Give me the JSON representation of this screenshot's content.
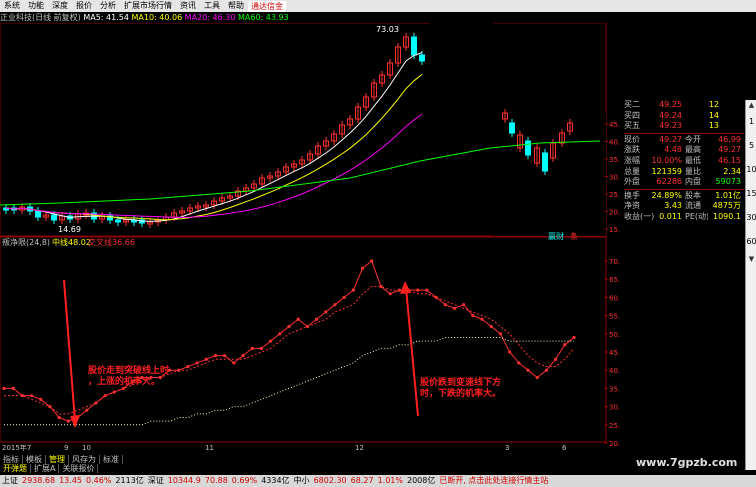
{
  "menu": {
    "items": [
      "系统",
      "功能",
      "深度",
      "报价",
      "分析",
      "扩展市场行情",
      "资讯",
      "工具",
      "帮助"
    ],
    "promo": "通达信金"
  },
  "legend": {
    "stock": "正业科技(日线 前复权)",
    "ma5": "MA5: 41.54",
    "ma10": "MA10: 40.06",
    "ma20": "MA20: 46.30",
    "ma60": "MA60: 43.93"
  },
  "price_chart": {
    "high_label": "73.03",
    "low_label": "14.69",
    "y_ticks": [
      "45.00",
      "40.00",
      "35.00",
      "30.00",
      "25.00",
      "20.00",
      "15.00"
    ]
  },
  "indicator": {
    "name": "叛净限(24,8)",
    "mid_label": "中线",
    "mid_value": "48.02",
    "cross_label": "交叉线",
    "cross_value": "36.66",
    "y_ticks": [
      "70.00",
      "65.00",
      "60.00",
      "55.00",
      "50.00",
      "45.00",
      "40.00",
      "35.00",
      "30.00",
      "25.00",
      "20.00"
    ]
  },
  "time_axis": [
    "2015年7",
    "9",
    "10",
    "11",
    "12",
    "3",
    "6"
  ],
  "annotations": {
    "left": [
      "股价走到突破线上时",
      "，上涨的机率大。"
    ],
    "right": [
      "股价跌到变速线下方",
      "时，下跌的机率大。"
    ]
  },
  "chart_data": {
    "type": "line",
    "title": "",
    "xlabel": "",
    "ylabel": "",
    "ylim": [
      20,
      75
    ],
    "series": [
      {
        "name": "",
        "values": [
          35,
          35,
          33,
          33,
          32,
          30,
          27,
          26,
          27,
          29,
          31,
          33,
          34,
          35,
          37,
          38,
          38,
          38,
          40,
          40,
          41,
          42,
          43,
          44,
          44,
          42,
          44,
          46,
          46,
          48,
          50,
          52,
          54,
          52,
          54,
          56,
          58,
          60,
          62,
          68,
          70,
          63,
          61,
          62,
          62,
          62,
          62,
          60,
          58,
          57,
          58,
          55,
          54,
          52,
          50,
          45,
          42,
          40,
          38,
          40,
          43,
          47,
          49
        ]
      },
      {
        "name": "",
        "values": [
          33,
          33,
          33,
          32,
          31,
          30,
          28,
          28,
          29,
          30,
          31,
          33,
          34,
          35,
          36,
          37,
          38,
          38,
          39,
          40,
          40,
          41,
          42,
          43,
          43,
          43,
          43,
          44,
          45,
          46,
          48,
          50,
          51,
          52,
          53,
          54,
          56,
          57,
          58,
          61,
          63,
          63,
          62,
          62,
          62,
          61,
          61,
          60,
          59,
          58,
          57,
          56,
          55,
          54,
          52,
          50,
          47,
          44,
          42,
          41,
          41,
          43,
          46
        ]
      },
      {
        "name": "",
        "values": [
          25,
          25,
          25,
          25,
          25,
          25,
          25,
          25,
          25,
          25,
          25,
          25,
          25,
          25,
          25,
          25,
          26,
          26,
          26,
          27,
          27,
          28,
          28,
          29,
          29,
          30,
          30,
          31,
          32,
          33,
          34,
          35,
          36,
          37,
          38,
          39,
          40,
          41,
          42,
          44,
          45,
          46,
          46,
          47,
          47,
          48,
          48,
          48,
          49,
          49,
          49,
          49,
          49,
          49,
          49,
          48,
          48,
          48,
          48,
          48,
          48,
          48,
          48
        ]
      }
    ]
  },
  "quote_panel": {
    "rows": [
      {
        "label": "买二",
        "value": "49.25",
        "extra": "12"
      },
      {
        "label": "买四",
        "value": "49.24",
        "extra": "14"
      },
      {
        "label": "买五",
        "value": "49.23",
        "extra": "13"
      },
      {
        "label": "现价",
        "value": "49.27",
        "label2": "今开",
        "value2": "46.99"
      },
      {
        "label": "涨跌",
        "value": "4.48",
        "label2": "最高",
        "value2": "49.27"
      },
      {
        "label": "涨幅",
        "value": "10.00%",
        "label2": "最低",
        "value2": "46.15"
      },
      {
        "label": "总量",
        "value": "121359",
        "label2": "量比",
        "value2": "2.34"
      },
      {
        "label": "外盘",
        "value": "62286",
        "label2": "内盘",
        "value2": "59073"
      },
      {
        "label": "换手",
        "value": "24.89%",
        "label2": "股本",
        "value2": "1.01亿"
      },
      {
        "label": "净资",
        "value": "3.43",
        "label2": "流通",
        "value2": "4875万"
      },
      {
        "label": "收益(一)",
        "value": "0.011",
        "label2": "PE(动)",
        "value2": "1090.1"
      }
    ],
    "tags": [
      "赢财",
      "条"
    ]
  },
  "scrollbar": {
    "labels": [
      "1",
      "5",
      "10",
      "15",
      "30",
      "60"
    ]
  },
  "tabs": {
    "row1": [
      "指标",
      "模板",
      "管理",
      "风存为",
      "标准"
    ],
    "row2": [
      "开弹题",
      "扩展A",
      "关联报价"
    ]
  },
  "status": {
    "sh_label": "上证",
    "sh_value": "2938.68",
    "sh_chg": "13.45",
    "sh_pct": "0.46%",
    "sh_amt": "2113亿",
    "sz_label": "深证",
    "sz_value": "10344.9",
    "sz_chg": "70.88",
    "sz_pct": "0.69%",
    "sz_amt": "4334亿",
    "zx_label": "中小",
    "zx_value": "6802.30",
    "zx_chg": "68.27",
    "zx_pct": "1.01%",
    "zx_amt": "2008亿",
    "msg": "已断开, 点击此处连接行情主站"
  },
  "watermark": "www.7gpzb.com",
  "colors": {
    "ma5": "#ffffff",
    "ma10": "#ffff00",
    "ma20": "#ff00ff",
    "ma60": "#00ff00",
    "up": "#ff3030",
    "down": "#00ffff"
  }
}
